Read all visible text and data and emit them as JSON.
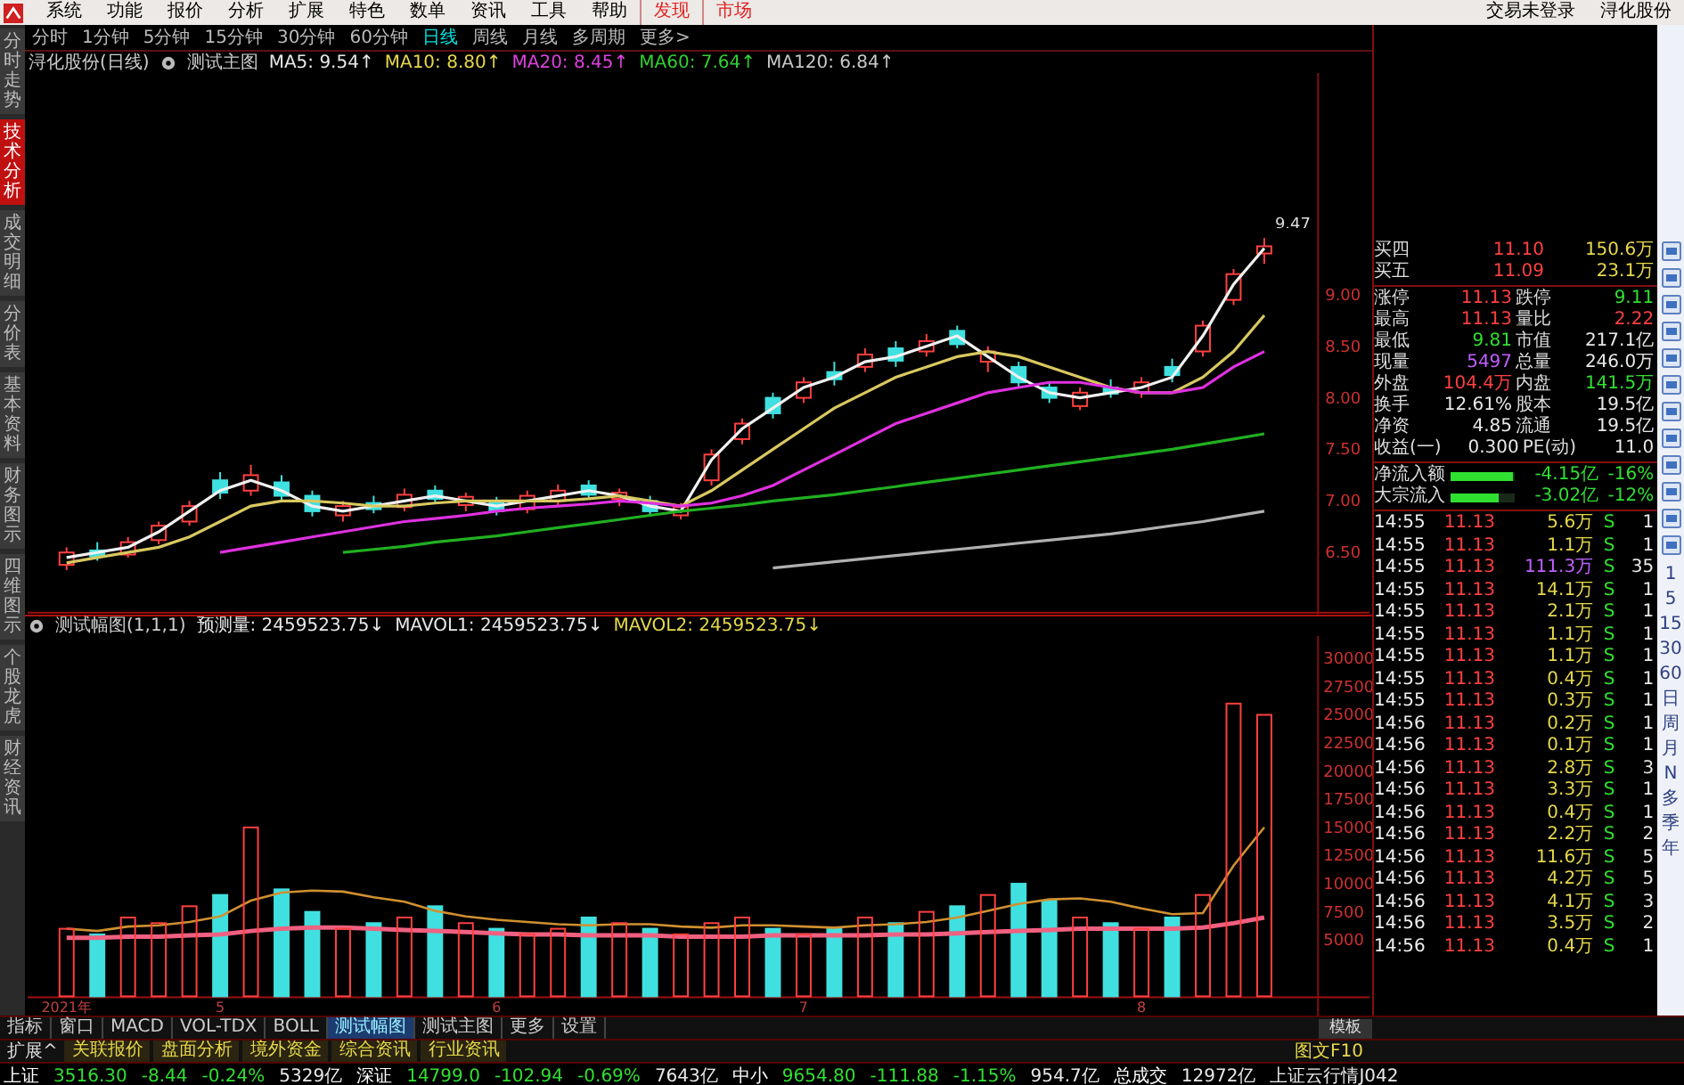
{
  "menu": {
    "items": [
      "系统",
      "功能",
      "报价",
      "分析",
      "扩展",
      "特色",
      "数单",
      "资讯",
      "工具",
      "帮助"
    ],
    "highlight_items": [
      "发现",
      "市场"
    ],
    "right_items": [
      "交易未登录",
      "浔化股份"
    ]
  },
  "side_tabs": [
    {
      "label": "分时走势",
      "selected": false
    },
    {
      "label": "技术分析",
      "selected": true
    },
    {
      "label": "成交明细",
      "selected": false
    },
    {
      "label": "分价表",
      "selected": false
    },
    {
      "label": "基本资料",
      "selected": false
    },
    {
      "label": "财务图示",
      "selected": false
    },
    {
      "label": "四维图示",
      "selected": false
    },
    {
      "label": "个股龙虎",
      "selected": false
    },
    {
      "label": "财经资讯",
      "selected": false
    }
  ],
  "periods": [
    {
      "label": "分时",
      "selected": false
    },
    {
      "label": "1分钟",
      "selected": false
    },
    {
      "label": "5分钟",
      "selected": false
    },
    {
      "label": "15分钟",
      "selected": false
    },
    {
      "label": "30分钟",
      "selected": false
    },
    {
      "label": "60分钟",
      "selected": false
    },
    {
      "label": "日线",
      "selected": true
    },
    {
      "label": "周线",
      "selected": false
    },
    {
      "label": "月线",
      "selected": false
    },
    {
      "label": "多周期",
      "selected": false
    },
    {
      "label": "更多>",
      "selected": false
    }
  ],
  "price_panel": {
    "title": "浔化股份(日线)",
    "indicator": "测试主图",
    "readings": [
      {
        "text": ": 9.54↑",
        "color": "#e8e8e8"
      },
      {
        "text": ": 8.80↑",
        "color": "#e6d84a"
      },
      {
        "text": ": 8.45↑",
        "color": "#e040e0"
      },
      {
        "text": ": 7.64↑",
        "color": "#30d030"
      },
      {
        "text": ": 6.84↑",
        "color": "#c8c8c8"
      }
    ],
    "high_label": "9.47",
    "chart_data": {
      "type": "candlestick",
      "categories": [
        null,
        null,
        null,
        null,
        null,
        null,
        null,
        null,
        null,
        null,
        null,
        null,
        null,
        null,
        null,
        null,
        null,
        null,
        null,
        null,
        null,
        null,
        null,
        null,
        null,
        null,
        null,
        null,
        null,
        null,
        null,
        null,
        null,
        null,
        null,
        null,
        null,
        null,
        null,
        null
      ],
      "ylim": [
        5.9,
        11.15
      ],
      "yticks": [
        {
          "value": 6.5,
          "label": "6.50"
        },
        {
          "value": 7.0,
          "label": "7.00"
        },
        {
          "value": 7.5,
          "label": "7.50"
        },
        {
          "value": 8.0,
          "label": "8.00"
        },
        {
          "value": 8.5,
          "label": "8.50"
        },
        {
          "value": 9.0,
          "label": "9.00"
        }
      ],
      "ohlc": [
        [
          6.38,
          6.55,
          6.33,
          6.5
        ],
        [
          6.52,
          6.6,
          6.42,
          6.46
        ],
        [
          6.48,
          6.65,
          6.45,
          6.6
        ],
        [
          6.62,
          6.8,
          6.58,
          6.76
        ],
        [
          6.8,
          7.0,
          6.76,
          6.95
        ],
        [
          7.2,
          7.28,
          7.02,
          7.08
        ],
        [
          7.1,
          7.35,
          7.05,
          7.25
        ],
        [
          7.18,
          7.25,
          7.0,
          7.05
        ],
        [
          7.05,
          7.1,
          6.85,
          6.9
        ],
        [
          6.86,
          7.0,
          6.8,
          6.95
        ],
        [
          6.98,
          7.05,
          6.88,
          6.92
        ],
        [
          6.94,
          7.12,
          6.9,
          7.06
        ],
        [
          7.1,
          7.15,
          6.98,
          7.02
        ],
        [
          6.96,
          7.08,
          6.9,
          7.04
        ],
        [
          7.0,
          7.04,
          6.86,
          6.9
        ],
        [
          6.92,
          7.1,
          6.88,
          7.05
        ],
        [
          7.0,
          7.16,
          6.96,
          7.1
        ],
        [
          7.15,
          7.2,
          7.02,
          7.06
        ],
        [
          7.02,
          7.12,
          6.95,
          7.08
        ],
        [
          7.0,
          7.05,
          6.86,
          6.9
        ],
        [
          6.86,
          6.98,
          6.82,
          6.94
        ],
        [
          7.2,
          7.5,
          7.15,
          7.45
        ],
        [
          7.6,
          7.8,
          7.55,
          7.75
        ],
        [
          8.0,
          8.05,
          7.8,
          7.85
        ],
        [
          8.0,
          8.2,
          7.95,
          8.15
        ],
        [
          8.25,
          8.35,
          8.12,
          8.18
        ],
        [
          8.3,
          8.48,
          8.25,
          8.42
        ],
        [
          8.48,
          8.55,
          8.3,
          8.36
        ],
        [
          8.45,
          8.62,
          8.4,
          8.55
        ],
        [
          8.65,
          8.7,
          8.48,
          8.52
        ],
        [
          8.35,
          8.5,
          8.25,
          8.45
        ],
        [
          8.3,
          8.35,
          8.1,
          8.15
        ],
        [
          8.1,
          8.15,
          7.95,
          8.0
        ],
        [
          7.92,
          8.1,
          7.88,
          8.05
        ],
        [
          8.1,
          8.18,
          8.0,
          8.04
        ],
        [
          8.05,
          8.2,
          8.0,
          8.15
        ],
        [
          8.3,
          8.38,
          8.15,
          8.22
        ],
        [
          8.45,
          8.75,
          8.4,
          8.7
        ],
        [
          8.95,
          9.25,
          8.9,
          9.2
        ],
        [
          9.4,
          9.55,
          9.3,
          9.47
        ]
      ],
      "series": [
        {
          "name": "MA5",
          "type": "line",
          "color": "#f0f0f0",
          "values": [
            6.45,
            6.5,
            6.55,
            6.7,
            6.9,
            7.1,
            7.2,
            7.1,
            6.95,
            6.9,
            6.95,
            7.0,
            7.05,
            7.0,
            6.95,
            7.0,
            7.05,
            7.1,
            7.05,
            6.95,
            6.9,
            7.4,
            7.7,
            7.9,
            8.1,
            8.2,
            8.35,
            8.4,
            8.5,
            8.6,
            8.4,
            8.2,
            8.05,
            8.0,
            8.05,
            8.1,
            8.2,
            8.6,
            9.1,
            9.45
          ]
        },
        {
          "name": "MA10",
          "type": "line",
          "color": "#d8c860",
          "values": [
            6.4,
            6.45,
            6.5,
            6.55,
            6.65,
            6.8,
            6.95,
            7.0,
            7.0,
            6.98,
            6.95,
            6.95,
            6.98,
            7.0,
            7.0,
            7.0,
            7.0,
            7.02,
            7.05,
            7.0,
            6.95,
            7.1,
            7.3,
            7.5,
            7.7,
            7.9,
            8.05,
            8.2,
            8.3,
            8.4,
            8.45,
            8.4,
            8.3,
            8.2,
            8.1,
            8.05,
            8.05,
            8.2,
            8.45,
            8.8
          ]
        },
        {
          "name": "MA20",
          "type": "line",
          "color": "#e030e0",
          "values": [
            null,
            null,
            null,
            null,
            null,
            6.5,
            6.55,
            6.6,
            6.65,
            6.7,
            6.75,
            6.8,
            6.83,
            6.86,
            6.9,
            6.93,
            6.95,
            6.97,
            7.0,
            6.98,
            6.95,
            6.98,
            7.05,
            7.15,
            7.3,
            7.45,
            7.6,
            7.75,
            7.85,
            7.95,
            8.05,
            8.1,
            8.15,
            8.15,
            8.1,
            8.05,
            8.05,
            8.1,
            8.3,
            8.45
          ]
        },
        {
          "name": "MA60",
          "type": "line",
          "color": "#20b020",
          "values": [
            null,
            null,
            null,
            null,
            null,
            null,
            null,
            null,
            null,
            6.5,
            6.53,
            6.56,
            6.6,
            6.63,
            6.66,
            6.7,
            6.74,
            6.78,
            6.82,
            6.86,
            6.9,
            6.93,
            6.96,
            7.0,
            7.03,
            7.06,
            7.1,
            7.14,
            7.18,
            7.22,
            7.26,
            7.3,
            7.34,
            7.38,
            7.42,
            7.46,
            7.5,
            7.55,
            7.6,
            7.65
          ]
        },
        {
          "name": "MA120",
          "type": "line",
          "color": "#b0b0b0",
          "values": [
            null,
            null,
            null,
            null,
            null,
            null,
            null,
            null,
            null,
            null,
            null,
            null,
            null,
            null,
            null,
            null,
            null,
            null,
            null,
            null,
            null,
            null,
            null,
            6.35,
            6.38,
            6.41,
            6.44,
            6.47,
            6.5,
            6.53,
            6.56,
            6.59,
            6.62,
            6.65,
            6.68,
            6.72,
            6.76,
            6.8,
            6.85,
            6.9
          ]
        }
      ]
    }
  },
  "volume_panel": {
    "title": "测试幅图(1,1,1)",
    "readings": [
      {
        "text": ": 2459523.75↓",
        "color": "#e8e8e8"
      },
      {
        "text": ": 2459523.75↓",
        "color": "#e8e8e8"
      },
      {
        "text": ": 2459523.75↓",
        "color": "#e6d84a"
      }
    ],
    "chart_data": {
      "type": "bar",
      "categories": [
        "2021年",
        null,
        null,
        null,
        null,
        "5",
        null,
        null,
        null,
        null,
        null,
        null,
        null,
        null,
        "6",
        null,
        null,
        null,
        null,
        null,
        null,
        null,
        null,
        null,
        "7",
        null,
        null,
        null,
        null,
        null,
        null,
        null,
        null,
        null,
        null,
        "8",
        null,
        null,
        null,
        null
      ],
      "ylim": [
        0,
        32000
      ],
      "yticks": [
        5000,
        7500,
        10000,
        12500,
        15000,
        17500,
        20000,
        22500,
        25000,
        27500,
        30000
      ],
      "series": [
        {
          "name": "预测量",
          "type": "bar",
          "color": "#40e0e0",
          "values": [
            null,
            5500,
            null,
            null,
            null,
            9000,
            null,
            9500,
            7500,
            null,
            6500,
            null,
            8000,
            null,
            6000,
            null,
            null,
            7000,
            null,
            6000,
            null,
            null,
            null,
            6000,
            null,
            6000,
            null,
            6500,
            null,
            8000,
            null,
            10000,
            8500,
            null,
            6500,
            null,
            7000,
            null,
            null,
            null
          ]
        },
        {
          "name": "MAVOL1",
          "type": "line",
          "color": "#d09030",
          "values": [
            6000,
            5800,
            6200,
            6300,
            6600,
            7100,
            8500,
            9200,
            9400,
            9300,
            8800,
            8400,
            7600,
            7100,
            6800,
            6600,
            6400,
            6300,
            6400,
            6400,
            6200,
            6100,
            6300,
            6300,
            6200,
            6100,
            6300,
            6400,
            6600,
            7000,
            7600,
            8200,
            8600,
            8700,
            8400,
            7800,
            7300,
            7400,
            11600,
            15000
          ]
        },
        {
          "name": "MAVOL2",
          "type": "line",
          "color": "#f06080",
          "values": [
            5200,
            5200,
            5300,
            5300,
            5400,
            5500,
            5800,
            6000,
            6100,
            6100,
            6000,
            5900,
            5800,
            5700,
            5600,
            5500,
            5500,
            5400,
            5400,
            5400,
            5300,
            5300,
            5300,
            5400,
            5400,
            5400,
            5400,
            5500,
            5500,
            5600,
            5700,
            5800,
            5900,
            6000,
            6000,
            6000,
            6000,
            6100,
            6500,
            7000
          ]
        },
        {
          "type": "bar",
          "color": "#ff4040",
          "values": [
            6000,
            null,
            7000,
            6500,
            8000,
            null,
            15000,
            null,
            null,
            6000,
            null,
            7000,
            null,
            6500,
            null,
            5500,
            6000,
            null,
            6500,
            null,
            5500,
            6500,
            7000,
            null,
            5500,
            null,
            7000,
            null,
            7500,
            null,
            9000,
            null,
            null,
            7000,
            null,
            6000,
            null,
            9000,
            26000,
            25000
          ]
        }
      ],
      "stacked": true
    }
  },
  "order_book": [
    {
      "label": "买四",
      "price": "11.10",
      "volume": "150.6万"
    },
    {
      "label": "买五",
      "price": "11.09",
      "volume": "23.1万"
    }
  ],
  "quote_rows": [
    {
      "cells": [
        {
          "label": "涨停",
          "value": "11.13",
          "color": "#ff4040"
        },
        {
          "label": "跌停",
          "value": "9.11",
          "color": "#30e030"
        }
      ]
    },
    {
      "cells": [
        {
          "label": "最高",
          "value": "11.13",
          "color": "#ff4040"
        },
        {
          "label": "量比",
          "value": "2.22",
          "color": "#ff4040"
        }
      ]
    },
    {
      "cells": [
        {
          "label": "最低",
          "value": "9.81",
          "color": "#30e030"
        },
        {
          "label": "市值",
          "value": "217.1亿",
          "color": "#e8e8e8"
        }
      ]
    },
    {
      "cells": [
        {
          "label": "现量",
          "value": "5497",
          "color": "#c060ff"
        },
        {
          "label": "总量",
          "value": "246.0万",
          "color": "#e8e8e8"
        }
      ]
    },
    {
      "cells": [
        {
          "label": "外盘",
          "value": "104.4万",
          "color": "#ff4040"
        },
        {
          "label": "内盘",
          "value": "141.5万",
          "color": "#30e030"
        }
      ]
    },
    {
      "cells": [
        {
          "label": "换手",
          "value": "12.61%",
          "color": "#e8e8e8"
        },
        {
          "label": "股本",
          "value": "19.5亿",
          "color": "#e8e8e8"
        }
      ]
    },
    {
      "cells": [
        {
          "label": "净资",
          "value": "4.85",
          "color": "#e8e8e8"
        },
        {
          "label": "流通",
          "value": "19.5亿",
          "color": "#e8e8e8"
        }
      ]
    },
    {
      "cells": [
        {
          "label": "收益(一)",
          "value": "0.300",
          "color": "#e8e8e8"
        },
        {
          "label": "PE(动)",
          "value": "11.0",
          "color": "#e8e8e8"
        }
      ]
    }
  ],
  "flows": [
    {
      "label": "净流入额",
      "level": 0.97,
      "amount": "-4.15亿",
      "percent": "-16%"
    },
    {
      "label": "大宗流入",
      "level": 0.75,
      "amount": "-3.02亿",
      "percent": "-12%"
    }
  ],
  "trades": [
    {
      "time": "14:55",
      "price": "11.13",
      "volume": "5.6万",
      "side": "S",
      "count": "1",
      "color": "#e6d84a"
    },
    {
      "time": "14:55",
      "price": "11.13",
      "volume": "1.1万",
      "side": "S",
      "count": "1",
      "color": "#e6d84a"
    },
    {
      "time": "14:55",
      "price": "11.13",
      "volume": "111.3万",
      "side": "S",
      "count": "35",
      "color": "#c060ff"
    },
    {
      "time": "14:55",
      "price": "11.13",
      "volume": "14.1万",
      "side": "S",
      "count": "1",
      "color": "#e6d84a"
    },
    {
      "time": "14:55",
      "price": "11.13",
      "volume": "2.1万",
      "side": "S",
      "count": "1",
      "color": "#e6d84a"
    },
    {
      "time": "14:55",
      "price": "11.13",
      "volume": "1.1万",
      "side": "S",
      "count": "1",
      "color": "#e6d84a"
    },
    {
      "time": "14:55",
      "price": "11.13",
      "volume": "1.1万",
      "side": "S",
      "count": "1",
      "color": "#e6d84a"
    },
    {
      "time": "14:55",
      "price": "11.13",
      "volume": "0.4万",
      "side": "S",
      "count": "1",
      "color": "#e6d84a"
    },
    {
      "time": "14:55",
      "price": "11.13",
      "volume": "0.3万",
      "side": "S",
      "count": "1",
      "color": "#e6d84a"
    },
    {
      "time": "14:56",
      "price": "11.13",
      "volume": "0.2万",
      "side": "S",
      "count": "1",
      "color": "#e6d84a"
    },
    {
      "time": "14:56",
      "price": "11.13",
      "volume": "0.1万",
      "side": "S",
      "count": "1",
      "color": "#e6d84a"
    },
    {
      "time": "14:56",
      "price": "11.13",
      "volume": "2.8万",
      "side": "S",
      "count": "3",
      "color": "#e6d84a"
    },
    {
      "time": "14:56",
      "price": "11.13",
      "volume": "3.3万",
      "side": "S",
      "count": "1",
      "color": "#e6d84a"
    },
    {
      "time": "14:56",
      "price": "11.13",
      "volume": "0.4万",
      "side": "S",
      "count": "1",
      "color": "#e6d84a"
    },
    {
      "time": "14:56",
      "price": "11.13",
      "volume": "2.2万",
      "side": "S",
      "count": "2",
      "color": "#e6d84a"
    },
    {
      "time": "14:56",
      "price": "11.13",
      "volume": "11.6万",
      "side": "S",
      "count": "5",
      "color": "#e6d84a"
    },
    {
      "time": "14:56",
      "price": "11.13",
      "volume": "4.2万",
      "side": "S",
      "count": "5",
      "color": "#e6d84a"
    },
    {
      "time": "14:56",
      "price": "11.13",
      "volume": "4.1万",
      "side": "S",
      "count": "3",
      "color": "#e6d84a"
    },
    {
      "time": "14:56",
      "price": "11.13",
      "volume": "3.5万",
      "side": "S",
      "count": "2",
      "color": "#e6d84a"
    },
    {
      "time": "14:56",
      "price": "11.13",
      "volume": "0.4万",
      "side": "S",
      "count": "1",
      "color": "#e6d84a"
    }
  ],
  "right_periods": [
    "1",
    "5",
    "15",
    "30",
    "60",
    "日",
    "周",
    "月",
    "N",
    "多",
    "季",
    "年"
  ],
  "bottom_tabs": [
    {
      "label": "指标",
      "selected": false
    },
    {
      "label": "窗口",
      "selected": false
    },
    {
      "label": "MACD",
      "selected": false
    },
    {
      "label": "VOL-TDX",
      "selected": false
    },
    {
      "label": "BOLL",
      "selected": false
    },
    {
      "label": "测试幅图",
      "selected": true
    },
    {
      "label": "测试主图",
      "selected": false
    },
    {
      "label": "更多",
      "selected": false
    },
    {
      "label": "设置",
      "selected": false
    }
  ],
  "template_button": "模板",
  "extension_bar": {
    "toggle": "扩展^",
    "items": [
      "关联报价",
      "盘面分析",
      "境外资金",
      "综合资讯",
      "行业资讯"
    ],
    "right": "图文F10"
  },
  "status_bar": [
    {
      "text": "上证",
      "color": "#ffffff"
    },
    {
      "text": "3516.30",
      "color": "#30e030"
    },
    {
      "text": "-8.44",
      "color": "#30e030"
    },
    {
      "text": "-0.24%",
      "color": "#30e030"
    },
    {
      "text": "5329亿",
      "color": "#e8e8e8"
    },
    {
      "text": "深证",
      "color": "#ffffff"
    },
    {
      "text": "14799.0",
      "color": "#30e030"
    },
    {
      "text": "-102.94",
      "color": "#30e030"
    },
    {
      "text": "-0.69%",
      "color": "#30e030"
    },
    {
      "text": "7643亿",
      "color": "#e8e8e8"
    },
    {
      "text": "中小",
      "color": "#ffffff"
    },
    {
      "text": "9654.80",
      "color": "#30e030"
    },
    {
      "text": "-111.88",
      "color": "#30e030"
    },
    {
      "text": "-1.15%",
      "color": "#30e030"
    },
    {
      "text": "954.7亿",
      "color": "#e8e8e8"
    },
    {
      "text": "总成交",
      "color": "#ffffff"
    },
    {
      "text": "12972亿",
      "color": "#e8e8e8"
    },
    {
      "text": "上证云行情J042",
      "color": "#e8e8e8"
    }
  ]
}
